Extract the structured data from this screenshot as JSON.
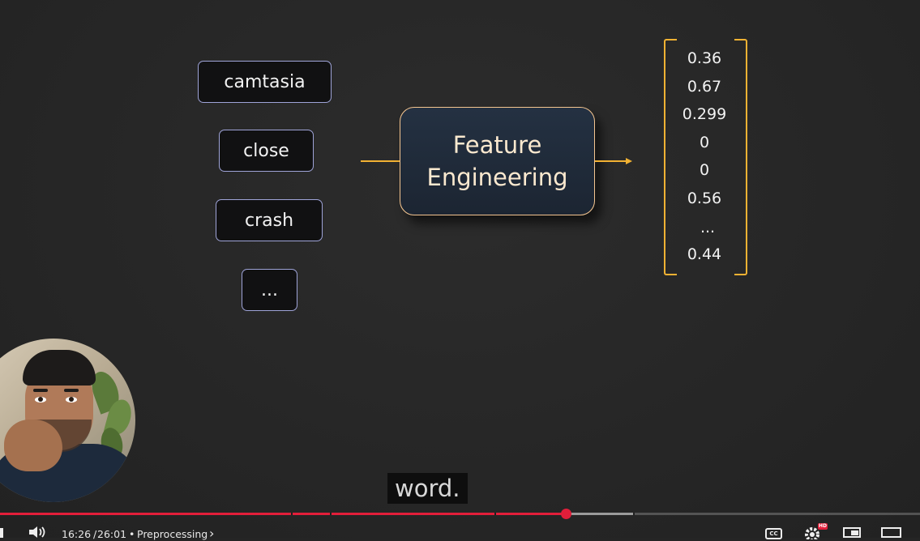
{
  "diagram": {
    "words": [
      "camtasia",
      "close",
      "crash",
      "..."
    ],
    "process_label_line1": "Feature",
    "process_label_line2": "Engineering",
    "vector_values": [
      "0.36",
      "0.67",
      "0.299",
      "0",
      "0",
      "0.56",
      "...",
      "0.44"
    ]
  },
  "caption": "word.",
  "player": {
    "time_current": "16:26",
    "time_separator": "/",
    "time_total": "26:01",
    "chapter_bullet": "•",
    "chapter_name": "Preprocessing",
    "chapter_chevron": "›",
    "progress_fraction": 0.616,
    "buffered_fraction": 0.69,
    "settings_badge": "HD",
    "cc_label": "CC",
    "accent_color": "#e21e3a"
  }
}
